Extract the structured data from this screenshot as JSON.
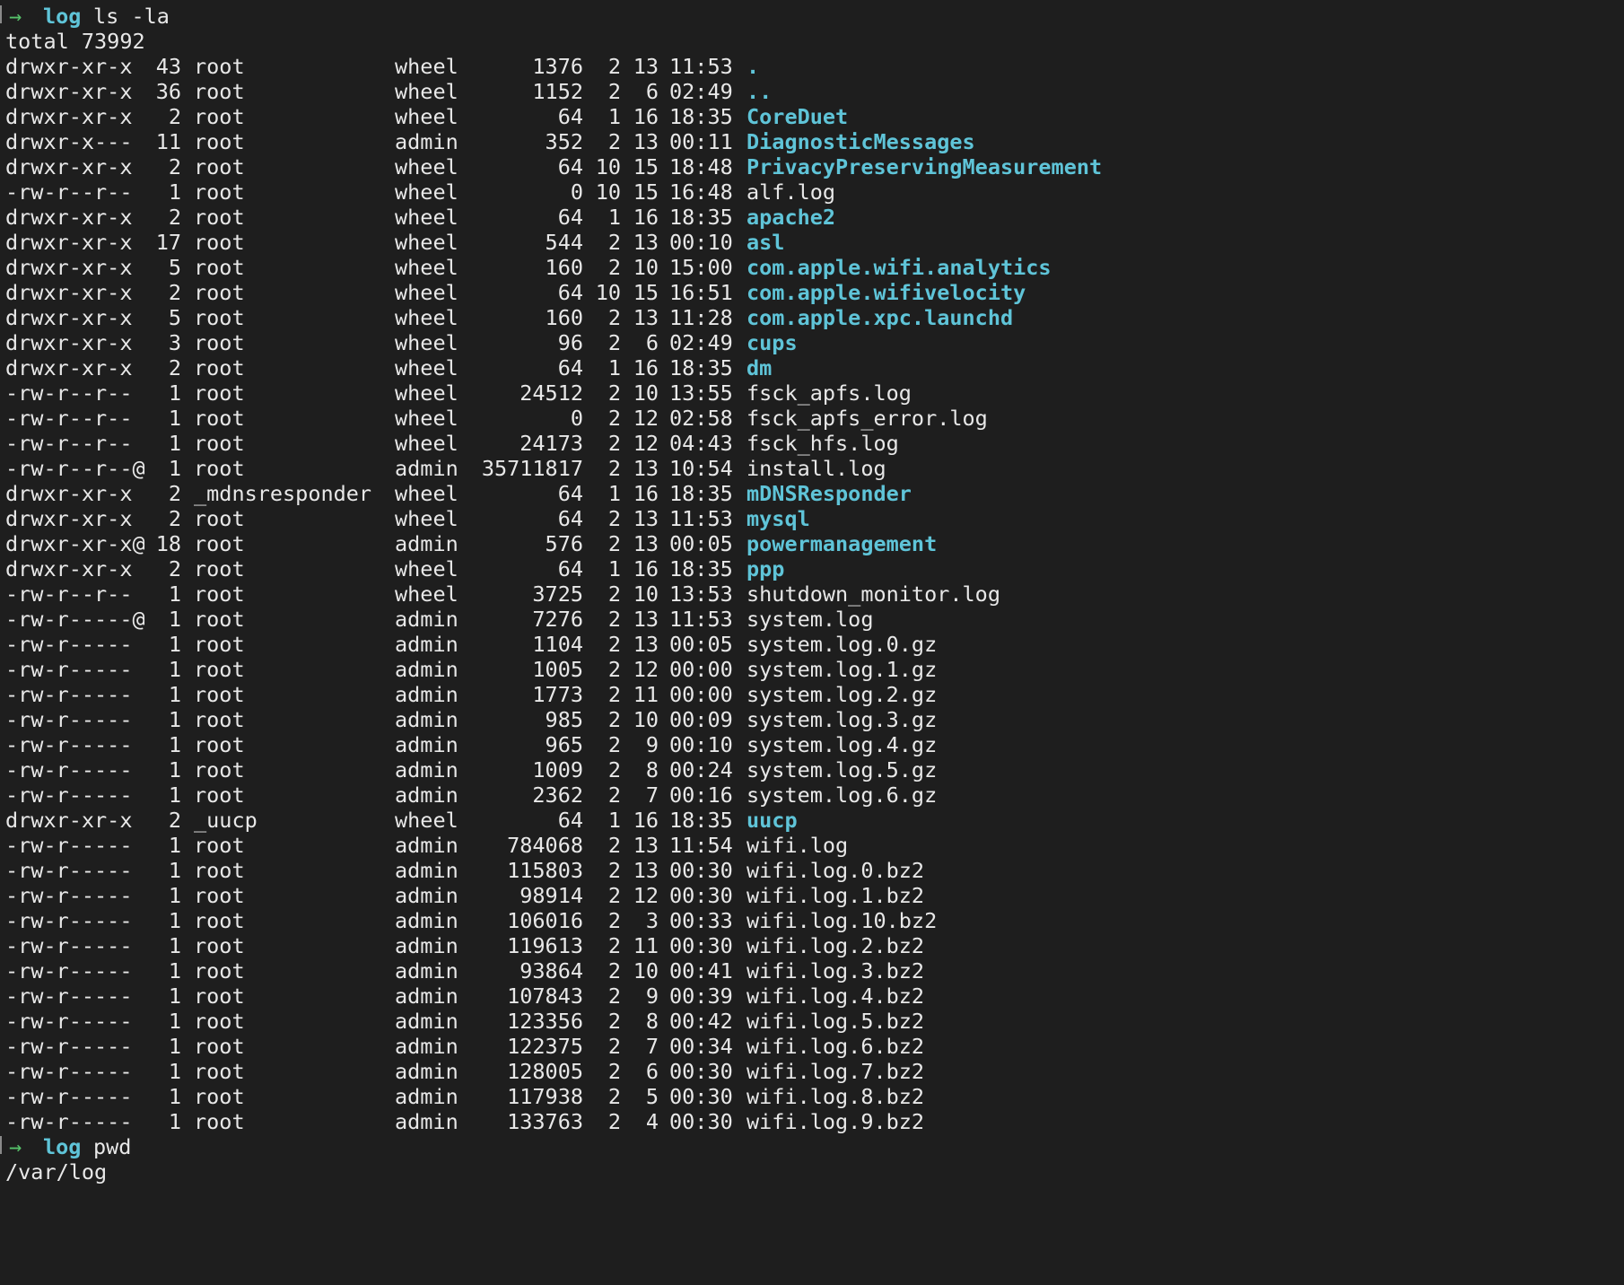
{
  "prompt": {
    "arrow": "→",
    "dir": "log"
  },
  "commands": [
    {
      "cmd": "ls -la"
    },
    {
      "cmd": "pwd"
    }
  ],
  "total_line": "total 73992",
  "listing": [
    {
      "perm": "drwxr-xr-x",
      "links": "43",
      "owner": "root",
      "group": "wheel",
      "size": "1376",
      "month": "2",
      "day": "13",
      "time": "11:53",
      "name": ".",
      "dir": true
    },
    {
      "perm": "drwxr-xr-x",
      "links": "36",
      "owner": "root",
      "group": "wheel",
      "size": "1152",
      "month": "2",
      "day": "6",
      "time": "02:49",
      "name": "..",
      "dir": true
    },
    {
      "perm": "drwxr-xr-x",
      "links": "2",
      "owner": "root",
      "group": "wheel",
      "size": "64",
      "month": "1",
      "day": "16",
      "time": "18:35",
      "name": "CoreDuet",
      "dir": true
    },
    {
      "perm": "drwxr-x---",
      "links": "11",
      "owner": "root",
      "group": "admin",
      "size": "352",
      "month": "2",
      "day": "13",
      "time": "00:11",
      "name": "DiagnosticMessages",
      "dir": true
    },
    {
      "perm": "drwxr-xr-x",
      "links": "2",
      "owner": "root",
      "group": "wheel",
      "size": "64",
      "month": "10",
      "day": "15",
      "time": "18:48",
      "name": "PrivacyPreservingMeasurement",
      "dir": true
    },
    {
      "perm": "-rw-r--r--",
      "links": "1",
      "owner": "root",
      "group": "wheel",
      "size": "0",
      "month": "10",
      "day": "15",
      "time": "16:48",
      "name": "alf.log",
      "dir": false
    },
    {
      "perm": "drwxr-xr-x",
      "links": "2",
      "owner": "root",
      "group": "wheel",
      "size": "64",
      "month": "1",
      "day": "16",
      "time": "18:35",
      "name": "apache2",
      "dir": true
    },
    {
      "perm": "drwxr-xr-x",
      "links": "17",
      "owner": "root",
      "group": "wheel",
      "size": "544",
      "month": "2",
      "day": "13",
      "time": "00:10",
      "name": "asl",
      "dir": true
    },
    {
      "perm": "drwxr-xr-x",
      "links": "5",
      "owner": "root",
      "group": "wheel",
      "size": "160",
      "month": "2",
      "day": "10",
      "time": "15:00",
      "name": "com.apple.wifi.analytics",
      "dir": true
    },
    {
      "perm": "drwxr-xr-x",
      "links": "2",
      "owner": "root",
      "group": "wheel",
      "size": "64",
      "month": "10",
      "day": "15",
      "time": "16:51",
      "name": "com.apple.wifivelocity",
      "dir": true
    },
    {
      "perm": "drwxr-xr-x",
      "links": "5",
      "owner": "root",
      "group": "wheel",
      "size": "160",
      "month": "2",
      "day": "13",
      "time": "11:28",
      "name": "com.apple.xpc.launchd",
      "dir": true
    },
    {
      "perm": "drwxr-xr-x",
      "links": "3",
      "owner": "root",
      "group": "wheel",
      "size": "96",
      "month": "2",
      "day": "6",
      "time": "02:49",
      "name": "cups",
      "dir": true
    },
    {
      "perm": "drwxr-xr-x",
      "links": "2",
      "owner": "root",
      "group": "wheel",
      "size": "64",
      "month": "1",
      "day": "16",
      "time": "18:35",
      "name": "dm",
      "dir": true
    },
    {
      "perm": "-rw-r--r--",
      "links": "1",
      "owner": "root",
      "group": "wheel",
      "size": "24512",
      "month": "2",
      "day": "10",
      "time": "13:55",
      "name": "fsck_apfs.log",
      "dir": false
    },
    {
      "perm": "-rw-r--r--",
      "links": "1",
      "owner": "root",
      "group": "wheel",
      "size": "0",
      "month": "2",
      "day": "12",
      "time": "02:58",
      "name": "fsck_apfs_error.log",
      "dir": false
    },
    {
      "perm": "-rw-r--r--",
      "links": "1",
      "owner": "root",
      "group": "wheel",
      "size": "24173",
      "month": "2",
      "day": "12",
      "time": "04:43",
      "name": "fsck_hfs.log",
      "dir": false
    },
    {
      "perm": "-rw-r--r--@",
      "links": "1",
      "owner": "root",
      "group": "admin",
      "size": "35711817",
      "month": "2",
      "day": "13",
      "time": "10:54",
      "name": "install.log",
      "dir": false
    },
    {
      "perm": "drwxr-xr-x",
      "links": "2",
      "owner": "_mdnsresponder",
      "group": "wheel",
      "size": "64",
      "month": "1",
      "day": "16",
      "time": "18:35",
      "name": "mDNSResponder",
      "dir": true
    },
    {
      "perm": "drwxr-xr-x",
      "links": "2",
      "owner": "root",
      "group": "wheel",
      "size": "64",
      "month": "2",
      "day": "13",
      "time": "11:53",
      "name": "mysql",
      "dir": true
    },
    {
      "perm": "drwxr-xr-x@",
      "links": "18",
      "owner": "root",
      "group": "admin",
      "size": "576",
      "month": "2",
      "day": "13",
      "time": "00:05",
      "name": "powermanagement",
      "dir": true
    },
    {
      "perm": "drwxr-xr-x",
      "links": "2",
      "owner": "root",
      "group": "wheel",
      "size": "64",
      "month": "1",
      "day": "16",
      "time": "18:35",
      "name": "ppp",
      "dir": true
    },
    {
      "perm": "-rw-r--r--",
      "links": "1",
      "owner": "root",
      "group": "wheel",
      "size": "3725",
      "month": "2",
      "day": "10",
      "time": "13:53",
      "name": "shutdown_monitor.log",
      "dir": false
    },
    {
      "perm": "-rw-r-----@",
      "links": "1",
      "owner": "root",
      "group": "admin",
      "size": "7276",
      "month": "2",
      "day": "13",
      "time": "11:53",
      "name": "system.log",
      "dir": false
    },
    {
      "perm": "-rw-r-----",
      "links": "1",
      "owner": "root",
      "group": "admin",
      "size": "1104",
      "month": "2",
      "day": "13",
      "time": "00:05",
      "name": "system.log.0.gz",
      "dir": false
    },
    {
      "perm": "-rw-r-----",
      "links": "1",
      "owner": "root",
      "group": "admin",
      "size": "1005",
      "month": "2",
      "day": "12",
      "time": "00:00",
      "name": "system.log.1.gz",
      "dir": false
    },
    {
      "perm": "-rw-r-----",
      "links": "1",
      "owner": "root",
      "group": "admin",
      "size": "1773",
      "month": "2",
      "day": "11",
      "time": "00:00",
      "name": "system.log.2.gz",
      "dir": false
    },
    {
      "perm": "-rw-r-----",
      "links": "1",
      "owner": "root",
      "group": "admin",
      "size": "985",
      "month": "2",
      "day": "10",
      "time": "00:09",
      "name": "system.log.3.gz",
      "dir": false
    },
    {
      "perm": "-rw-r-----",
      "links": "1",
      "owner": "root",
      "group": "admin",
      "size": "965",
      "month": "2",
      "day": "9",
      "time": "00:10",
      "name": "system.log.4.gz",
      "dir": false
    },
    {
      "perm": "-rw-r-----",
      "links": "1",
      "owner": "root",
      "group": "admin",
      "size": "1009",
      "month": "2",
      "day": "8",
      "time": "00:24",
      "name": "system.log.5.gz",
      "dir": false
    },
    {
      "perm": "-rw-r-----",
      "links": "1",
      "owner": "root",
      "group": "admin",
      "size": "2362",
      "month": "2",
      "day": "7",
      "time": "00:16",
      "name": "system.log.6.gz",
      "dir": false
    },
    {
      "perm": "drwxr-xr-x",
      "links": "2",
      "owner": "_uucp",
      "group": "wheel",
      "size": "64",
      "month": "1",
      "day": "16",
      "time": "18:35",
      "name": "uucp",
      "dir": true
    },
    {
      "perm": "-rw-r-----",
      "links": "1",
      "owner": "root",
      "group": "admin",
      "size": "784068",
      "month": "2",
      "day": "13",
      "time": "11:54",
      "name": "wifi.log",
      "dir": false
    },
    {
      "perm": "-rw-r-----",
      "links": "1",
      "owner": "root",
      "group": "admin",
      "size": "115803",
      "month": "2",
      "day": "13",
      "time": "00:30",
      "name": "wifi.log.0.bz2",
      "dir": false
    },
    {
      "perm": "-rw-r-----",
      "links": "1",
      "owner": "root",
      "group": "admin",
      "size": "98914",
      "month": "2",
      "day": "12",
      "time": "00:30",
      "name": "wifi.log.1.bz2",
      "dir": false
    },
    {
      "perm": "-rw-r-----",
      "links": "1",
      "owner": "root",
      "group": "admin",
      "size": "106016",
      "month": "2",
      "day": "3",
      "time": "00:33",
      "name": "wifi.log.10.bz2",
      "dir": false
    },
    {
      "perm": "-rw-r-----",
      "links": "1",
      "owner": "root",
      "group": "admin",
      "size": "119613",
      "month": "2",
      "day": "11",
      "time": "00:30",
      "name": "wifi.log.2.bz2",
      "dir": false
    },
    {
      "perm": "-rw-r-----",
      "links": "1",
      "owner": "root",
      "group": "admin",
      "size": "93864",
      "month": "2",
      "day": "10",
      "time": "00:41",
      "name": "wifi.log.3.bz2",
      "dir": false
    },
    {
      "perm": "-rw-r-----",
      "links": "1",
      "owner": "root",
      "group": "admin",
      "size": "107843",
      "month": "2",
      "day": "9",
      "time": "00:39",
      "name": "wifi.log.4.bz2",
      "dir": false
    },
    {
      "perm": "-rw-r-----",
      "links": "1",
      "owner": "root",
      "group": "admin",
      "size": "123356",
      "month": "2",
      "day": "8",
      "time": "00:42",
      "name": "wifi.log.5.bz2",
      "dir": false
    },
    {
      "perm": "-rw-r-----",
      "links": "1",
      "owner": "root",
      "group": "admin",
      "size": "122375",
      "month": "2",
      "day": "7",
      "time": "00:34",
      "name": "wifi.log.6.bz2",
      "dir": false
    },
    {
      "perm": "-rw-r-----",
      "links": "1",
      "owner": "root",
      "group": "admin",
      "size": "128005",
      "month": "2",
      "day": "6",
      "time": "00:30",
      "name": "wifi.log.7.bz2",
      "dir": false
    },
    {
      "perm": "-rw-r-----",
      "links": "1",
      "owner": "root",
      "group": "admin",
      "size": "117938",
      "month": "2",
      "day": "5",
      "time": "00:30",
      "name": "wifi.log.8.bz2",
      "dir": false
    },
    {
      "perm": "-rw-r-----",
      "links": "1",
      "owner": "root",
      "group": "admin",
      "size": "133763",
      "month": "2",
      "day": "4",
      "time": "00:30",
      "name": "wifi.log.9.bz2",
      "dir": false
    }
  ],
  "pwd_output": "/var/log",
  "colors": {
    "background": "#1e1e1e",
    "text": "#e8e8e8",
    "directory": "#5fc4d8",
    "prompt_arrow": "#56c26a"
  }
}
